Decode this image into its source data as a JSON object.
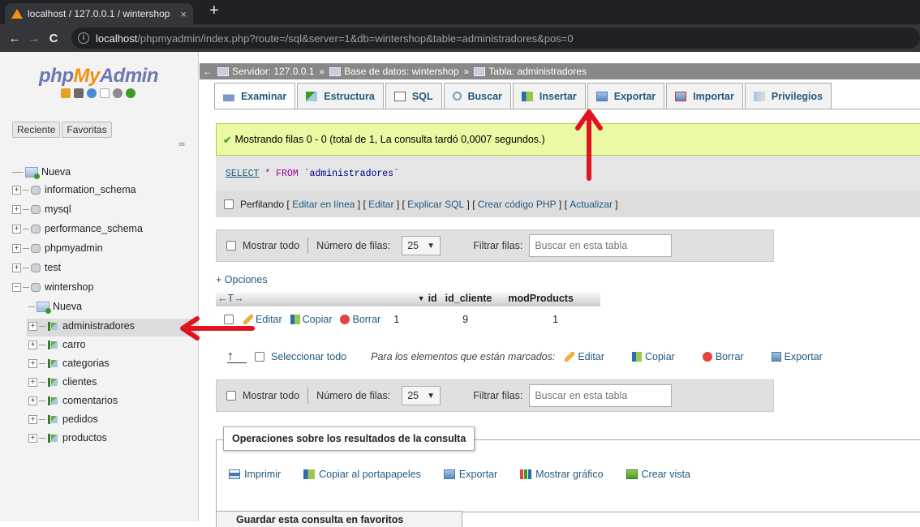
{
  "browser": {
    "tab_title": "localhost / 127.0.0.1 / wintershop",
    "tab_close": "×",
    "new_tab": "+",
    "back": "←",
    "forward": "→",
    "reload": "C",
    "url_host": "localhost",
    "url_path": "/phpmyadmin/index.php?route=/sql&server=1&db=wintershop&table=administradores&pos=0"
  },
  "sidebar": {
    "logo_php": "php",
    "logo_my": "My",
    "logo_admin": "Admin",
    "recent": "Reciente",
    "favorites": "Favoritas",
    "link_icon": "∞",
    "tree": {
      "new": "Nueva",
      "information_schema": "information_schema",
      "mysql": "mysql",
      "performance_schema": "performance_schema",
      "phpmyadmin": "phpmyadmin",
      "test": "test",
      "wintershop": "wintershop",
      "wintershop_new": "Nueva",
      "administradores": "administradores",
      "carro": "carro",
      "categorias": "categorias",
      "clientes": "clientes",
      "comentarios": "comentarios",
      "pedidos": "pedidos",
      "productos": "productos"
    }
  },
  "breadcrumb": {
    "server": "Servidor: 127.0.0.1",
    "database": "Base de datos: wintershop",
    "table": "Tabla: administradores",
    "sep": "»"
  },
  "tabs": [
    "Examinar",
    "Estructura",
    "SQL",
    "Buscar",
    "Insertar",
    "Exportar",
    "Importar",
    "Privilegios"
  ],
  "success_message": "Mostrando filas 0 - 0 (total de 1, La consulta tardó 0,0007 segundos.)",
  "sql": {
    "select": "SELECT",
    "star": "*",
    "from": "FROM",
    "table": "`administradores`"
  },
  "profiling": {
    "label": "Perfilando",
    "links": [
      "Editar en línea",
      "Editar",
      "Explicar SQL",
      "Crear código PHP",
      "Actualizar"
    ]
  },
  "nav": {
    "show_all": "Mostrar todo",
    "rows_label": "Número de filas:",
    "rows_value": "25",
    "filter_label": "Filtrar filas:",
    "filter_placeholder": "Buscar en esta tabla"
  },
  "options_link": "+ Opciones",
  "table": {
    "arrows": "←T→",
    "columns": [
      "id",
      "id_cliente",
      "modProducts"
    ],
    "rows": [
      {
        "id": "1",
        "id_cliente": "9",
        "modProducts": "1"
      }
    ],
    "row_actions": [
      "Editar",
      "Copiar",
      "Borrar"
    ]
  },
  "bulk": {
    "select_all": "Seleccionar todo",
    "marked_label": "Para los elementos que están marcados:",
    "actions": [
      "Editar",
      "Copiar",
      "Borrar",
      "Exportar"
    ]
  },
  "operations": {
    "title": "Operaciones sobre los resultados de la consulta",
    "links": [
      "Imprimir",
      "Copiar al portapapeles",
      "Exportar",
      "Mostrar gráfico",
      "Crear vista"
    ]
  },
  "bookmark_title": "Guardar esta consulta en favoritos",
  "colors": {
    "accent_link": "#235a81",
    "success_bg": "#ebf8a4",
    "annotation_arrow": "#e0141e"
  }
}
